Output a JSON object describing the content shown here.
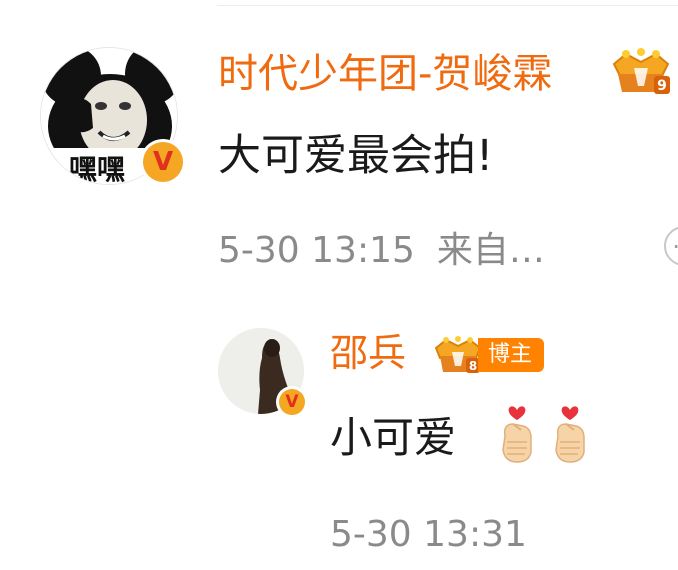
{
  "main_comment": {
    "username": "时代少年团-贺峻霖",
    "avatar_caption": "嘿嘿",
    "verified_mark": "V",
    "crown_level": "9",
    "text": "大可爱最会拍!",
    "time": "5-30 13:15",
    "source": "来自…",
    "more_icon": "more-circle-icon"
  },
  "reply": {
    "username": "邵兵",
    "verified_mark": "V",
    "crown_level": "8",
    "badge": "博主",
    "text": "小可爱",
    "emojis": [
      "finger-heart-emoji",
      "finger-heart-emoji"
    ],
    "time": "5-30 13:31"
  },
  "colors": {
    "username": "#f06a0f",
    "badge_bg": "#ff8200",
    "meta_text": "#8a8a8a",
    "verified_bg": "#f5a623"
  }
}
